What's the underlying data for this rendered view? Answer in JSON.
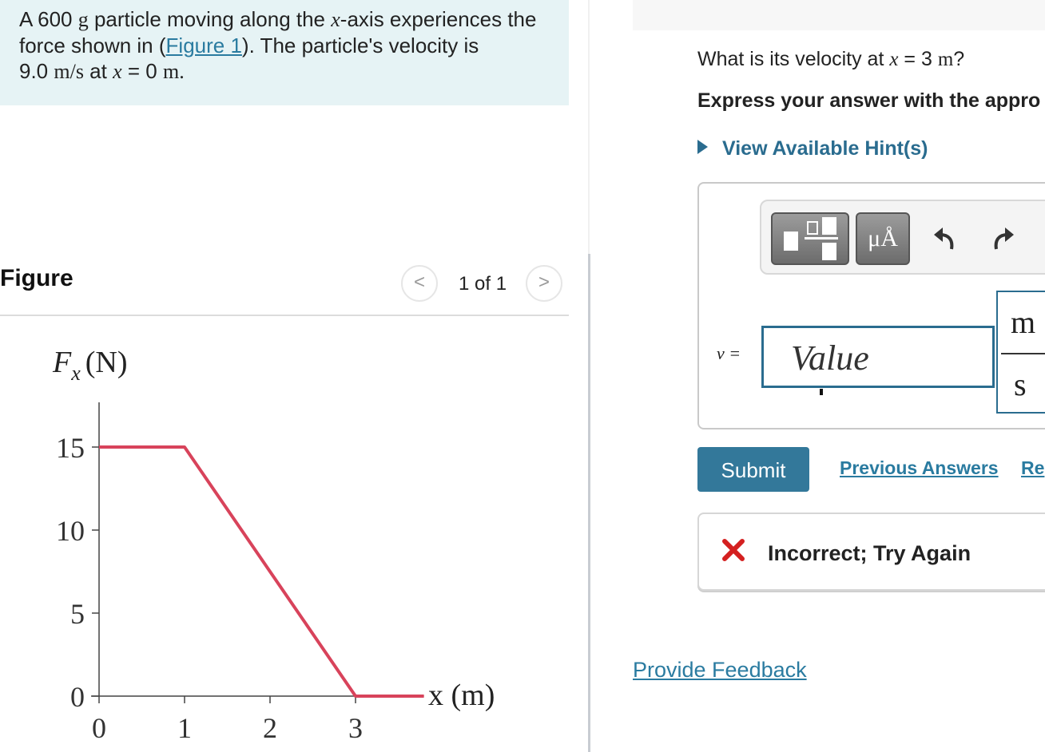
{
  "problem": {
    "line1_a": "A 600 ",
    "line1_unit": "g",
    "line1_b": " particle moving along the ",
    "line1_var": "x",
    "line1_c": "-axis experiences the",
    "line2_a": "force shown in (",
    "line2_link": "Figure 1",
    "line2_b": "). The particle's velocity is",
    "line3_val": "9.0 ",
    "line3_unit": "m/s",
    "line3_a": " at ",
    "line3_var": "x",
    "line3_b": " = 0 ",
    "line3_unit2": "m."
  },
  "figure": {
    "title": "Figure",
    "pager_text": "1 of 1",
    "prev_glyph": "<",
    "next_glyph": ">"
  },
  "chart_data": {
    "type": "line",
    "ylabel_main": "F",
    "ylabel_sub": "x",
    "ylabel_unit": "(N)",
    "xlabel": "x (m)",
    "xlim": [
      0,
      4
    ],
    "ylim": [
      0,
      15
    ],
    "x_ticks": [
      "0",
      "1",
      "2",
      "3"
    ],
    "y_ticks": [
      "0",
      "5",
      "10",
      "15"
    ],
    "series": [
      {
        "x": [
          0,
          1,
          3,
          3.8
        ],
        "y": [
          15,
          15,
          0,
          0
        ],
        "color": "#d8435b"
      }
    ]
  },
  "question": {
    "text_a": "What is its velocity at ",
    "text_var": "x",
    "text_b": " = 3 ",
    "text_unit": "m",
    "text_c": "?",
    "instruction": "Express your answer with the appro",
    "hint": "View Available Hint(s)"
  },
  "answer": {
    "toolbar_symbol_label": "μÅ",
    "variable_label": "v =",
    "input_placeholder": "Value",
    "unit_numerator": "m",
    "unit_denominator": "s"
  },
  "actions": {
    "submit": "Submit",
    "previous_answers": "Previous Answers",
    "request_answer": "Re"
  },
  "feedback": {
    "text": "Incorrect; Try Again",
    "provide_feedback": "Provide Feedback"
  },
  "colors": {
    "accent": "#2a6c8f",
    "submit_bg": "#33789a",
    "graph_line": "#d8435b",
    "error": "#d42020",
    "problem_bg": "#e6f3f5"
  }
}
